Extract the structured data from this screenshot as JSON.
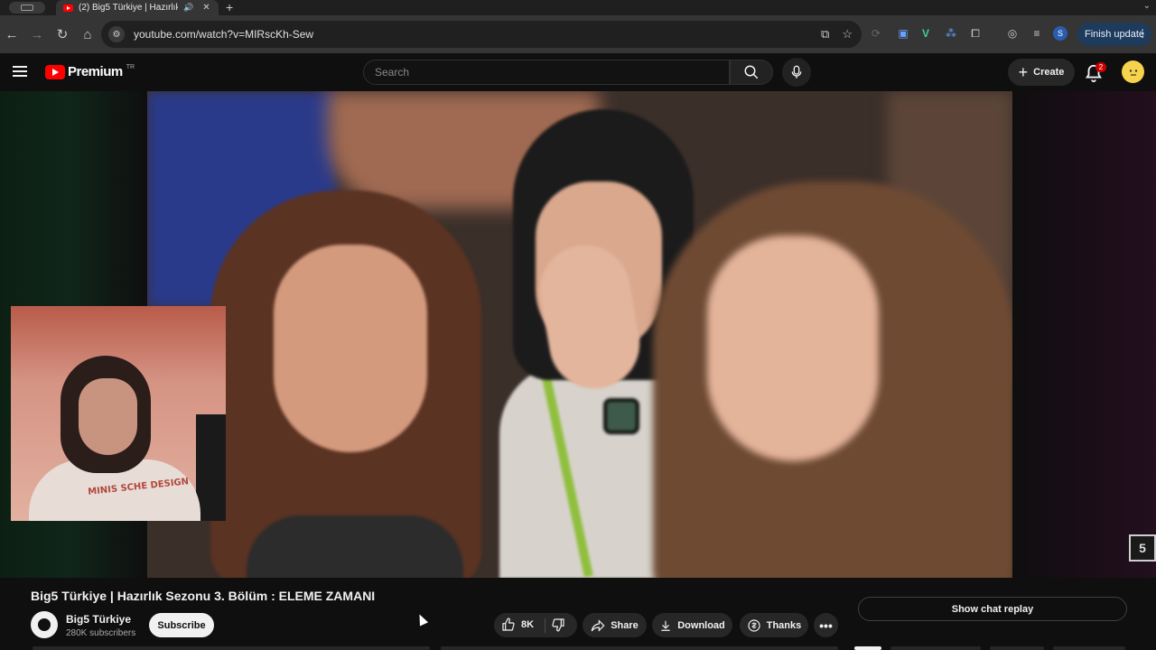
{
  "browser": {
    "tab_title": "(2) Big5 Türkiye | Hazırlık",
    "url": "youtube.com/watch?v=MIRscKh-Sew",
    "finish_update_label": "Finish update",
    "profile_initial": "S"
  },
  "header": {
    "logo_text": "Premium",
    "logo_region": "TR",
    "search_placeholder": "Search",
    "create_label": "Create",
    "notification_count": "2"
  },
  "video": {
    "title": "Big5 Türkiye | Hazırlık Sezonu 3. Bölüm : ELEME ZAMANI",
    "channel_name": "Big5 Türkiye",
    "subscribers": "280K subscribers",
    "subscribe_label": "Subscribe",
    "like_count": "8K",
    "share_label": "Share",
    "download_label": "Download",
    "thanks_label": "Thanks",
    "more_label": "•••",
    "chat_replay_label": "Show chat replay",
    "webcam_shirt_text": "MINIS SCHE DESIGN",
    "corner_logo": "5"
  },
  "colors": {
    "brand": "#ff0000",
    "background": "#0f0f0f",
    "pill": "#272727",
    "update_button": "#1f3b5c"
  }
}
